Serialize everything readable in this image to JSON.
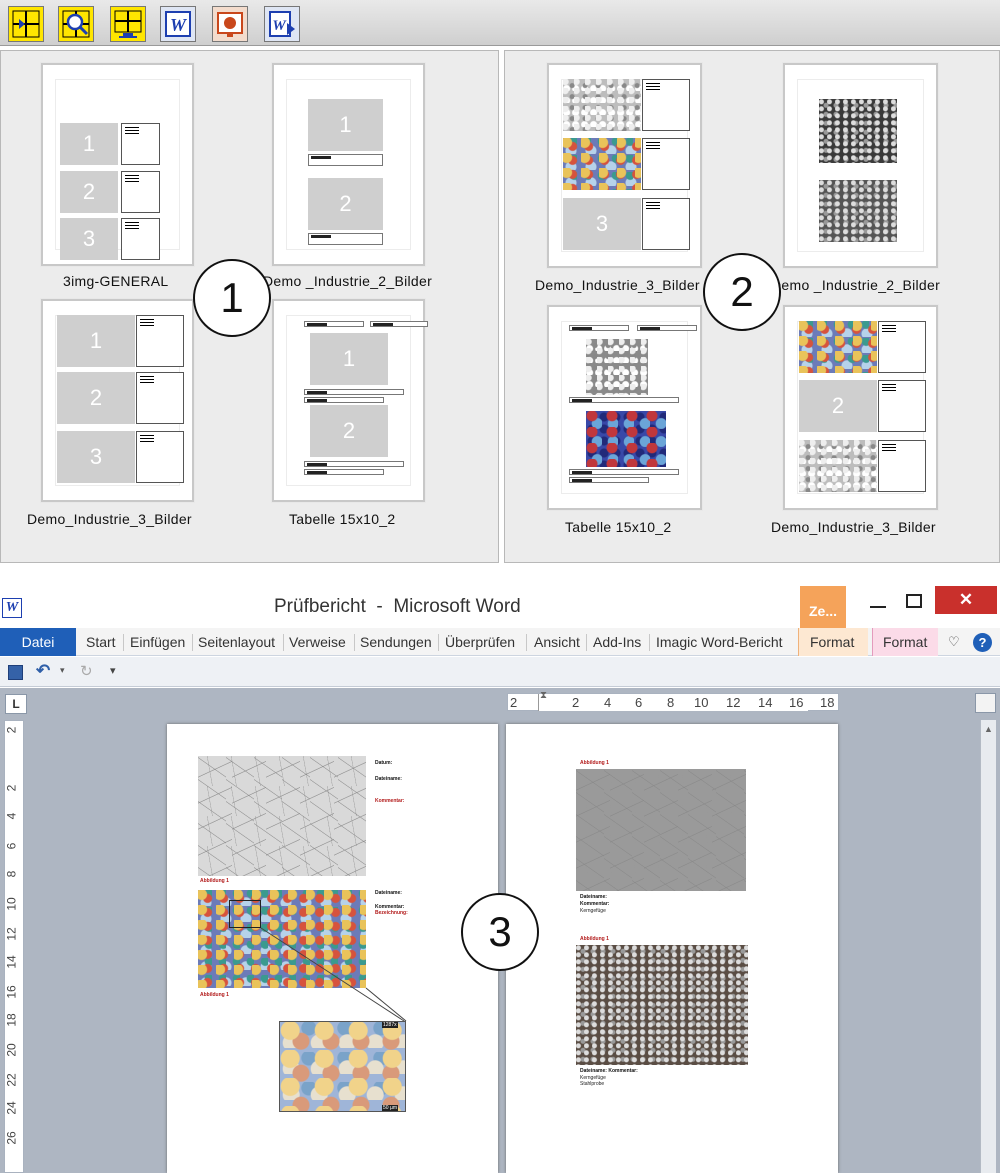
{
  "toolbar": {
    "buttons": [
      {
        "icon": "layout-add-icon"
      },
      {
        "icon": "layout-search-icon"
      },
      {
        "icon": "monitor-grid-icon"
      },
      {
        "icon": "word-icon",
        "letter": "W"
      },
      {
        "icon": "powerpoint-icon"
      },
      {
        "icon": "word-export-icon",
        "letter": "W"
      }
    ]
  },
  "panel1": {
    "marker": "1",
    "templates": [
      {
        "label": "3img-GENERAL",
        "placeholders": [
          "1",
          "2",
          "3"
        ]
      },
      {
        "label": "Demo _Industrie_2_Bilder",
        "placeholders": [
          "1",
          "2"
        ]
      },
      {
        "label": "Demo_Industrie_3_Bilder",
        "placeholders": [
          "1",
          "2",
          "3"
        ]
      },
      {
        "label": "Tabelle 15x10_2",
        "placeholders": [
          "1",
          "2"
        ]
      }
    ]
  },
  "panel2": {
    "marker": "2",
    "templates": [
      {
        "label": "Demo_Industrie_3_Bilder",
        "placeholders": [
          "3"
        ]
      },
      {
        "label": "Demo _Industrie_2_Bilder"
      },
      {
        "label": "Tabelle 15x10_2"
      },
      {
        "label": "Demo_Industrie_3_Bilder",
        "placeholders": [
          "2"
        ]
      }
    ]
  },
  "word": {
    "title": "Prüfbericht  -  Microsoft Word",
    "context_tab": "Ze...",
    "tabs": [
      "Datei",
      "Start",
      "Einfügen",
      "Seitenlayout",
      "Verweise",
      "Sendungen",
      "Überprüfen",
      "Ansicht",
      "Add-Ins",
      "Imagic Word-Bericht",
      "Format",
      "Format"
    ],
    "hruler_ticks": [
      "2",
      "2",
      "4",
      "6",
      "8",
      "10",
      "12",
      "14",
      "16",
      "18"
    ],
    "vruler_ticks": [
      "2",
      "2",
      "4",
      "6",
      "8",
      "10",
      "12",
      "14",
      "16",
      "18",
      "20",
      "22",
      "24",
      "26"
    ],
    "marker": "3",
    "page1": {
      "fields": [
        "Datum:",
        "Dateiname:",
        "Kommentar:",
        "Dateiname:",
        "Kommentar:",
        "Bezeichnung:"
      ],
      "captions": [
        "Abbildung 1",
        "Abbildung 1"
      ],
      "scale_labels": [
        "1287x",
        "50 µm"
      ]
    },
    "page2": {
      "captions": [
        "Abbildung 1",
        "Abbildung 1"
      ],
      "fields": [
        "Dateiname:",
        "Kommentar:",
        "Dateiname: Kommentar:"
      ],
      "values": [
        "Kerngefüge",
        "Kerngefüge",
        "Stahlprobe"
      ]
    }
  }
}
